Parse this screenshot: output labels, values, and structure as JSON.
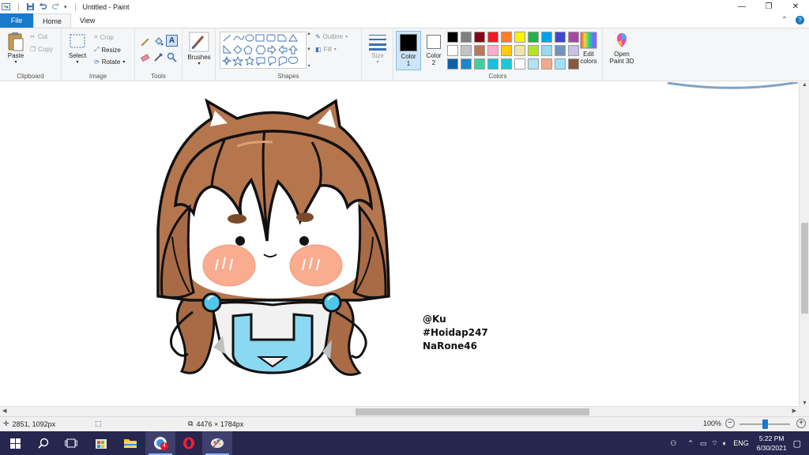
{
  "window": {
    "title": "Untitled - Paint"
  },
  "tabs": [
    {
      "label": "File"
    },
    {
      "label": "Home"
    },
    {
      "label": "View"
    }
  ],
  "ribbon": {
    "clipboard": {
      "label": "Clipboard",
      "paste": "Paste",
      "cut": "Cut",
      "copy": "Copy"
    },
    "image": {
      "label": "Image",
      "select": "Select",
      "crop": "Crop",
      "resize": "Resize",
      "rotate": "Rotate"
    },
    "tools": {
      "label": "Tools"
    },
    "brushes": {
      "label": "Brushes"
    },
    "shapes": {
      "label": "Shapes",
      "outline": "Outline",
      "fill": "Fill"
    },
    "size": {
      "label": "Size"
    },
    "color1": {
      "label": "Color",
      "num": "1",
      "value": "#000000"
    },
    "color2": {
      "label": "Color",
      "num": "2",
      "value": "#ffffff"
    },
    "colors": {
      "label": "Colors",
      "edit_label": "Edit",
      "edit_label2": "colors",
      "swatches": [
        "#000000",
        "#7f7f7f",
        "#880015",
        "#ed1c24",
        "#ff7f27",
        "#fff200",
        "#22b14c",
        "#00a2e8",
        "#3f48cc",
        "#a349a4",
        "#ffffff",
        "#c3c3c3",
        "#b97a57",
        "#ffaec9",
        "#ffc90e",
        "#efe4b0",
        "#b5e61d",
        "#99d9ea",
        "#7092be",
        "#c8bfe7",
        "#0b5fa8",
        "#1e86c9",
        "#3cd1a0",
        "#12c3dd",
        "#1ec9d6",
        "#ffffff",
        "#b2e3f4",
        "#f4a98a",
        "#9fe2f7",
        "#8a5a3c"
      ]
    },
    "paint3d": {
      "label": "Open",
      "label2": "Paint 3D"
    }
  },
  "canvas": {
    "signature": [
      "@Ku",
      "#Hoidap247",
      "NaRone46"
    ]
  },
  "status": {
    "cursor": "2851, 1092px",
    "image_size": "4476 × 1784px",
    "zoom": "100%"
  },
  "taskbar": {
    "mail_badge": "4",
    "lang": "ENG",
    "time": "5:22 PM",
    "date": "6/30/2021"
  }
}
